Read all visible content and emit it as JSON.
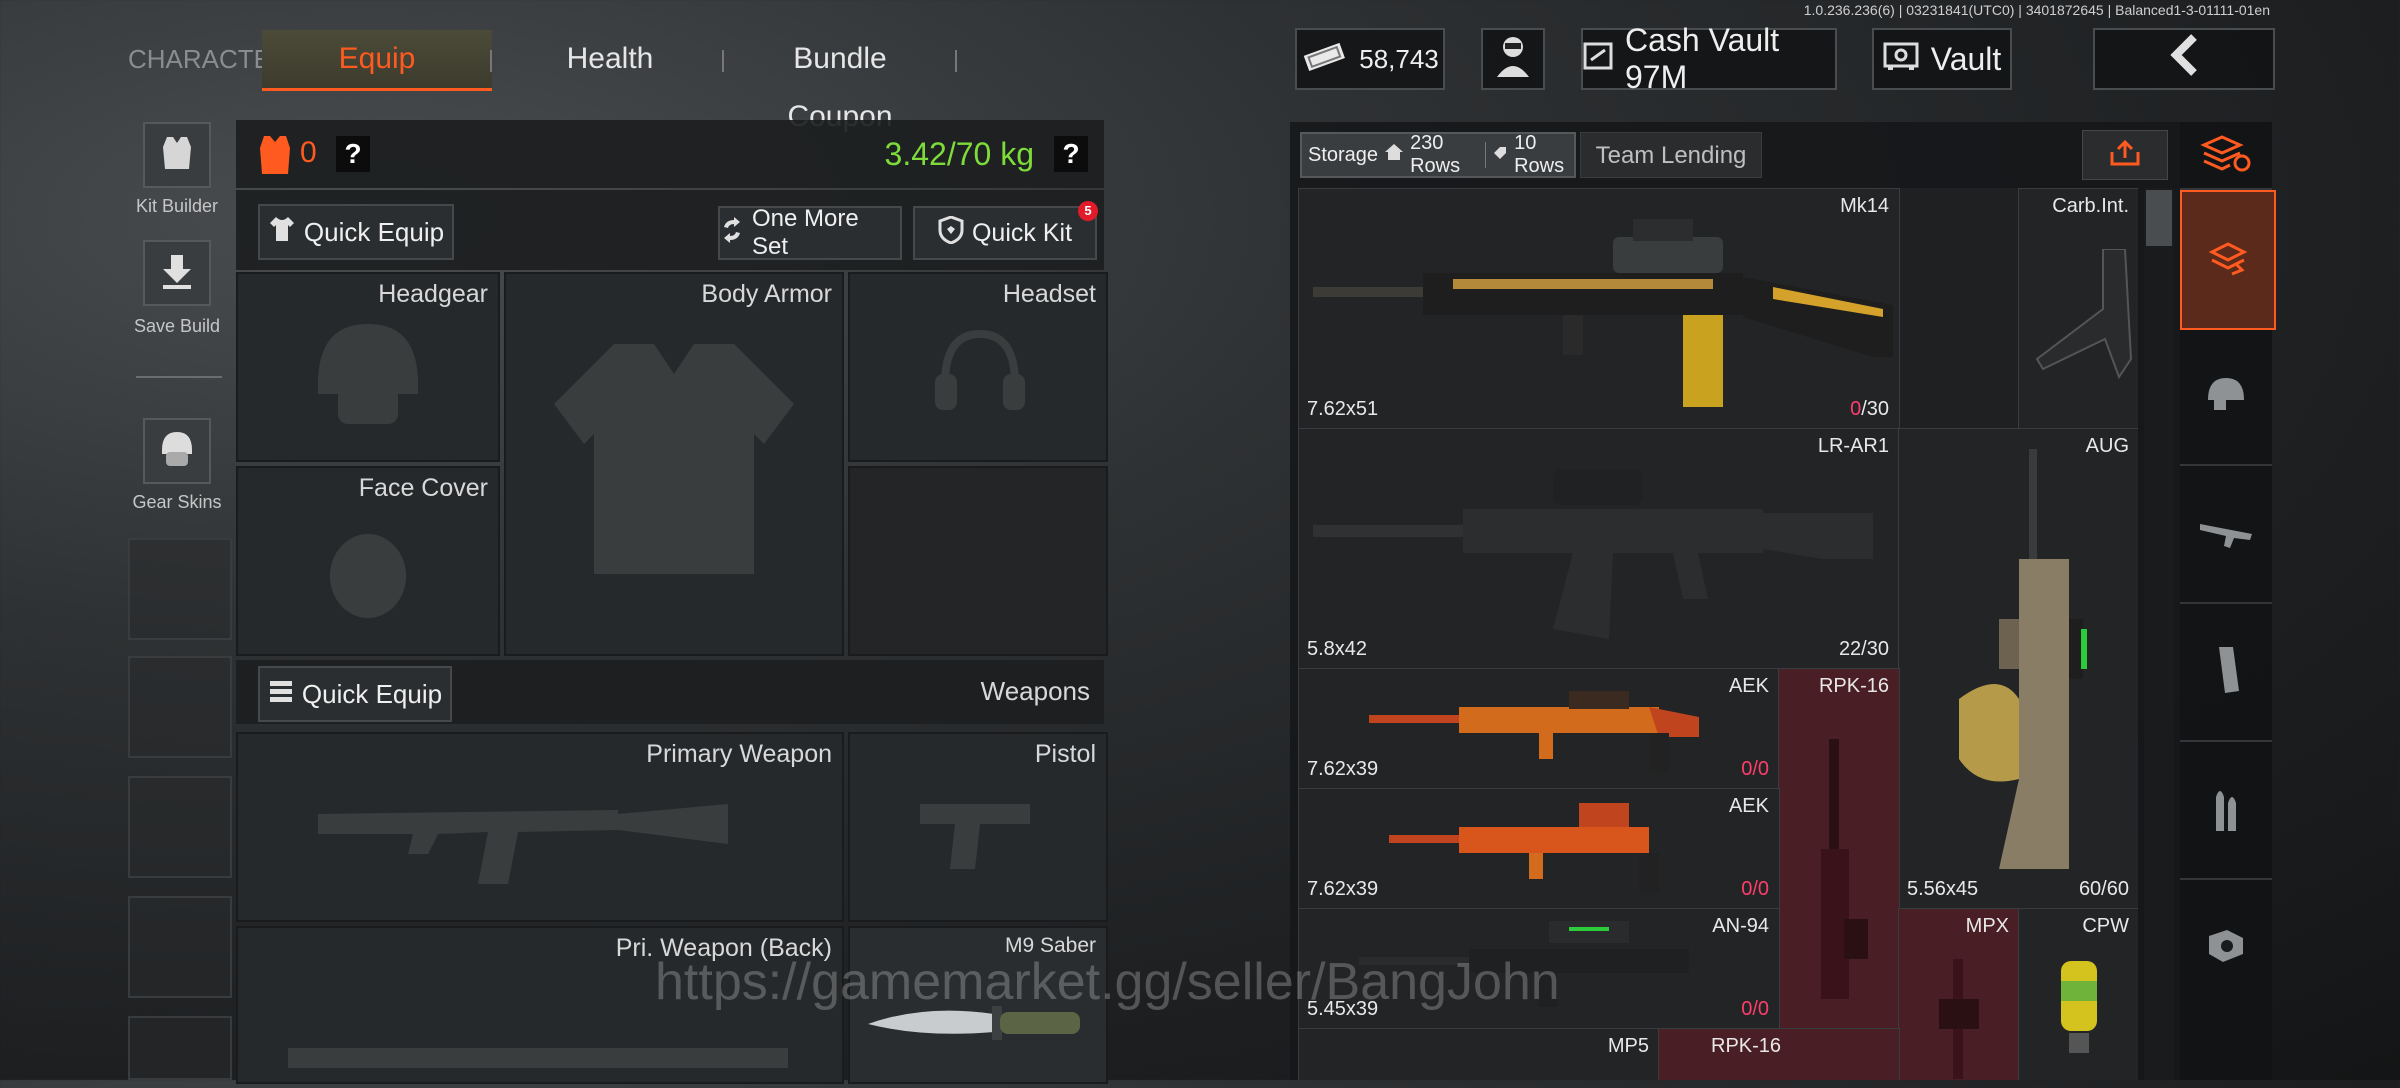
{
  "version": "1.0.236.236(6) | 03231841(UTC0) | 3401872645 | Balanced1-3-01111-01en",
  "tabs": {
    "character": "CHARACTER",
    "equip": "Equip",
    "health": "Health",
    "bundle": "Bundle Coupon"
  },
  "currency": {
    "value": "58,743",
    "cash_vault": "Cash Vault 97M",
    "vault": "Vault"
  },
  "sidebar": {
    "kit_builder": "Kit Builder",
    "save_build": "Save Build",
    "gear_skins": "Gear Skins"
  },
  "loadout": {
    "armor_count": "0",
    "help": "?",
    "weight": "3.42/70 kg",
    "quick_equip": "Quick Equip",
    "one_more_set": "One More Set",
    "quick_kit": "Quick Kit",
    "quick_kit_badge": "5",
    "slots": {
      "headgear": "Headgear",
      "body_armor": "Body Armor",
      "headset": "Headset",
      "face_cover": "Face Cover"
    },
    "weapons_title": "Weapons",
    "weapons_quick_equip": "Quick Equip",
    "weapon_slots": {
      "primary": "Primary Weapon",
      "pistol": "Pistol",
      "pri_back": "Pri. Weapon (Back)",
      "melee": "M9 Saber"
    }
  },
  "storage": {
    "label": "Storage",
    "rows_home": "230 Rows",
    "rows_other": "10 Rows",
    "team_lending": "Team Lending",
    "items": [
      {
        "name": "Mk14",
        "caliber": "7.62x51",
        "ammo_cur": "0",
        "ammo_max": "/30"
      },
      {
        "name": "Carb.Int."
      },
      {
        "name": "LR-AR1",
        "caliber": "5.8x42",
        "ammo": "22/30"
      },
      {
        "name": "AUG",
        "caliber": "5.56x45",
        "ammo": "60/60"
      },
      {
        "name": "AEK",
        "caliber": "7.62x39",
        "ammo_cur": "0",
        "ammo_max": "/0"
      },
      {
        "name": "RPK-16"
      },
      {
        "name": "AEK",
        "caliber": "7.62x39",
        "ammo_cur": "0",
        "ammo_max": "/0"
      },
      {
        "name": "AN-94",
        "caliber": "5.45x39",
        "ammo_cur": "0",
        "ammo_max": "/0"
      },
      {
        "name": "MPX"
      },
      {
        "name": "CPW"
      },
      {
        "name": "MP5"
      },
      {
        "name": "RPK-16"
      }
    ]
  },
  "watermark": "https://gamemarket.gg/seller/BangJohn",
  "colors": {
    "accent": "#ff5a1f",
    "weight": "#7ddc3a",
    "red_cell": "#4a1e25",
    "ammo_red": "#ff3d6a"
  }
}
